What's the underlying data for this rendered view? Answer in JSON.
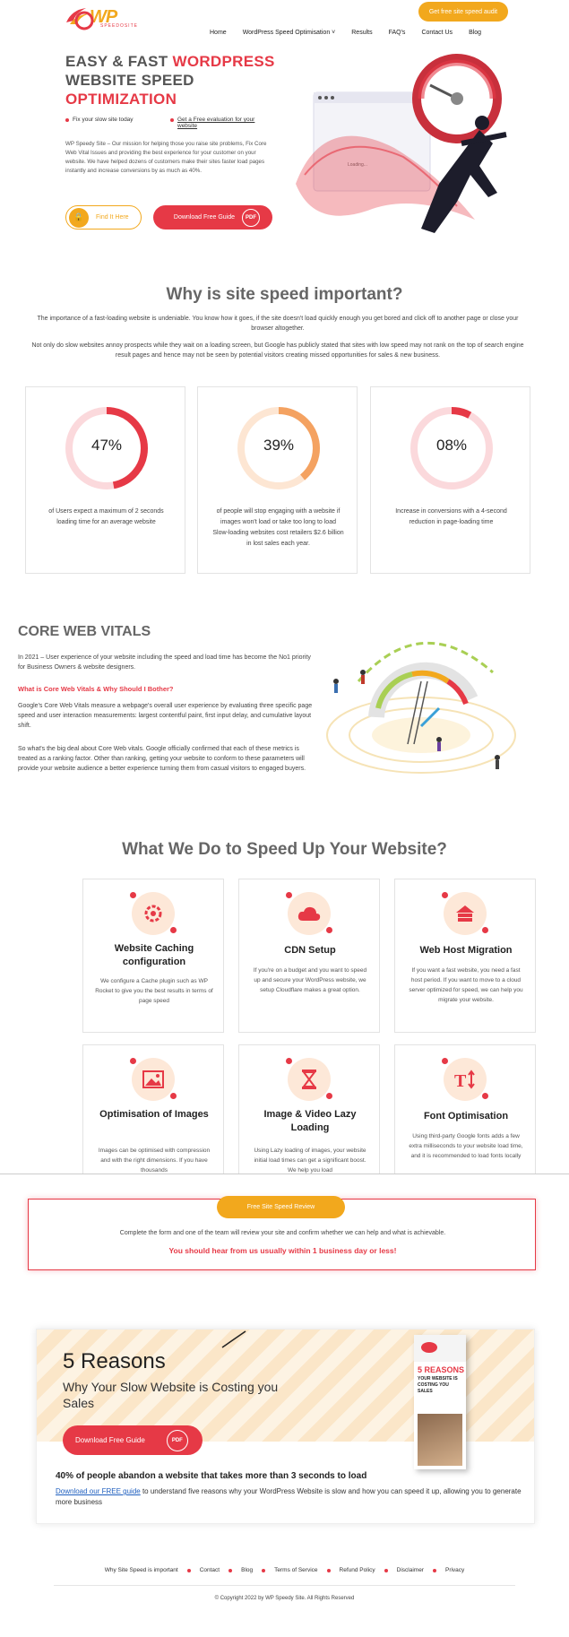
{
  "header": {
    "logo_text": "WP",
    "logo_sub": "SPEEDOSITE",
    "cta": "Get free site speed audit",
    "nav": [
      "Home",
      "WordPress Speed Optimisation ˅",
      "Results",
      "FAQ's",
      "Contact Us",
      "Blog"
    ]
  },
  "hero": {
    "title_1": "EASY & FAST ",
    "title_1_red": "WORDPRESS",
    "title_2": "WEBSITE SPEED",
    "title_3_red": "OPTIMIZATION",
    "bullet_1": "Fix your slow site today",
    "bullet_2": "Get a Free evaluation for your website",
    "paragraph": "WP Speedy Site – Our mission for helping those you raise site problems, Fix Core Web Vital Issues and providing the best experience for your customer on your website. We have helped dozens of customers make their sites faster load pages instantly and increase conversions by as much as 40%.",
    "find_button": "Find It Here",
    "guide_button": "Download Free Guide",
    "pdf": "PDF",
    "art_loading": "Loading..."
  },
  "why": {
    "title": "Why is site speed important?",
    "p1": "The importance of a fast-loading website is undeniable. You know how it goes, if the site doesn't load quickly enough you get bored and click off to another page or close your browser altogether.",
    "p2": "Not only do slow websites annoy prospects while they wait on a loading screen, but Google has publicly stated that sites with low speed may not rank on the top of search engine result pages and hence may not be seen by potential visitors creating missed opportunities for sales & new business.",
    "stats": [
      {
        "value": "47%",
        "fraction": 0.47,
        "color": "#e63946",
        "track": "#fbd9dc",
        "text": "of Users expect a maximum of 2 seconds loading time for an average website"
      },
      {
        "value": "39%",
        "fraction": 0.39,
        "color": "#f4a261",
        "track": "#fde6d3",
        "text": "of people will stop engaging with a website if images won't load or take too long to load Slow-loading websites cost retailers $2.6 billion in lost sales each year."
      },
      {
        "value": "08%",
        "fraction": 0.08,
        "color": "#e63946",
        "track": "#fbd9dc",
        "text": "Increase in conversions with a 4-second reduction in page-loading time"
      }
    ]
  },
  "cwv": {
    "title": "CORE WEB VITALS",
    "p1": "In 2021 – User experience of your website including the speed and load time has become the No1 priority for Business Owners & website designers.",
    "heading": "What is Core Web Vitals & Why Should I Bother?",
    "p2": "Google's Core Web Vitals measure a webpage's overall user experience by evaluating three specific page speed and user interaction measurements: largest contentful paint, first input delay, and cumulative layout shift.",
    "p3": "So what's the big deal about Core Web vitals. Google officially confirmed that each of these metrics is treated as a ranking factor. Other than ranking, getting your website to conform to these parameters will provide your website audience a better experience turning them from casual visitors to engaged buyers."
  },
  "services": {
    "title": "What We Do to Speed Up Your Website?",
    "items": [
      {
        "icon": "gear-speed-icon",
        "title": "Website Caching configuration",
        "text": "We configure a Cache plugin such as WP Rocket to give you the best results in terms of page speed"
      },
      {
        "icon": "cloud-icon",
        "title": "CDN Setup",
        "text": "If you're on a budget and you want to speed up and secure your WordPress website, we setup Cloudflare makes a great option."
      },
      {
        "icon": "server-icon",
        "title": "Web Host Migration",
        "text": "If you want a fast website, you need a fast host period. If you want to move to a cloud server optimized for speed, we can help you migrate your website."
      },
      {
        "icon": "image-icon",
        "title": "Optimisation of Images",
        "text": "Images can be optimised with compression and with the right dimensions. If you have thousands"
      },
      {
        "icon": "hourglass-icon",
        "title": "Image & Video Lazy Loading",
        "text": "Using Lazy loading of images, your website initial load times can get a significant boost. We help you load"
      },
      {
        "icon": "font-icon",
        "title": "Font Optimisation",
        "text": "Using third-party Google fonts adds a few extra milliseconds to your website load time, and it is recommended to load fonts locally"
      }
    ]
  },
  "review": {
    "pill": "Free Site Speed Review",
    "text": "Complete the form and one of the team will review your site and confirm whether we can help and what is achievable.",
    "red": "You should hear from us usually within 1 business day or less!"
  },
  "reasons": {
    "title": "5 Reasons",
    "subtitle": "Why Your Slow Website is Costing you Sales",
    "button": "Download Free Guide",
    "pdf": "PDF",
    "stat": "40% of people abandon a website that takes more than 3 seconds to load",
    "link": "Download our FREE guide",
    "rest": " to understand five reasons why your WordPress Website is slow and how you can speed it up, allowing you to generate more business",
    "book_title": "5 REASONS",
    "book_sub": "YOUR WEBSITE IS COSTING YOU SALES"
  },
  "footer": {
    "links": [
      "Why Site Speed is important",
      "Contact",
      "Blog",
      "Terms of Service",
      "Refund Policy",
      "Disclaimer",
      "Privacy"
    ],
    "copyright": "© Copyright 2022 by WP Speedy Site. All Rights Reserved"
  }
}
